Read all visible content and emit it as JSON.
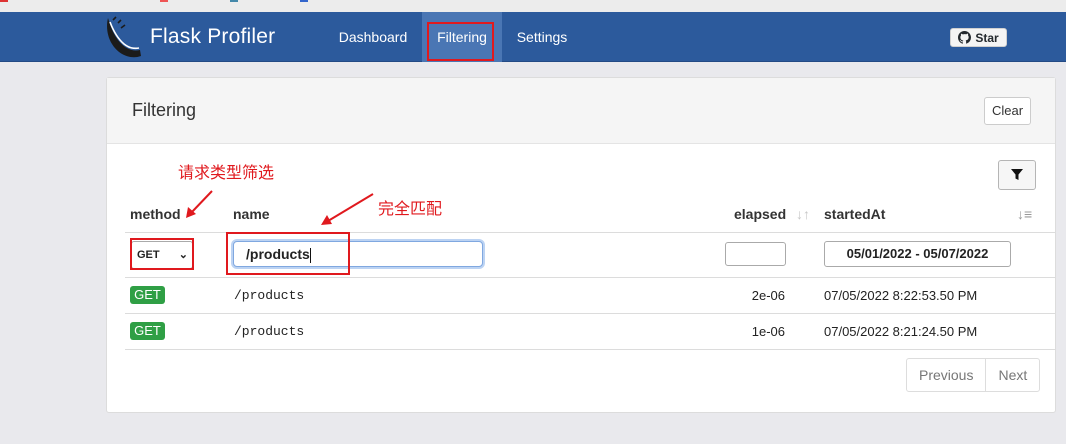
{
  "navbar": {
    "brand": "Flask Profiler",
    "items": [
      "Dashboard",
      "Filtering",
      "Settings"
    ],
    "active_item": "Filtering",
    "star_label": "Star",
    "bg_color": "#2c5a9c"
  },
  "panel": {
    "title": "Filtering",
    "clear_label": "Clear",
    "filter_icon": "funnel-icon"
  },
  "table": {
    "headers": {
      "method": "method",
      "name": "name",
      "elapsed": "elapsed",
      "startedAt": "startedAt"
    },
    "filters": {
      "method_value": "GET",
      "name_value": "/products",
      "elapsed_value": "",
      "date_range": "05/01/2022 - 05/07/2022"
    },
    "rows": [
      {
        "method": "GET",
        "name": "/products",
        "elapsed": "2e-06",
        "startedAt": "07/05/2022 8:22:53.50 PM"
      },
      {
        "method": "GET",
        "name": "/products",
        "elapsed": "1e-06",
        "startedAt": "07/05/2022 8:21:24.50 PM"
      }
    ]
  },
  "pagination": {
    "previous": "Previous",
    "next": "Next"
  },
  "annotations": {
    "method_note": "请求类型筛选",
    "name_note": "完全匹配",
    "color": "#e0191e"
  }
}
